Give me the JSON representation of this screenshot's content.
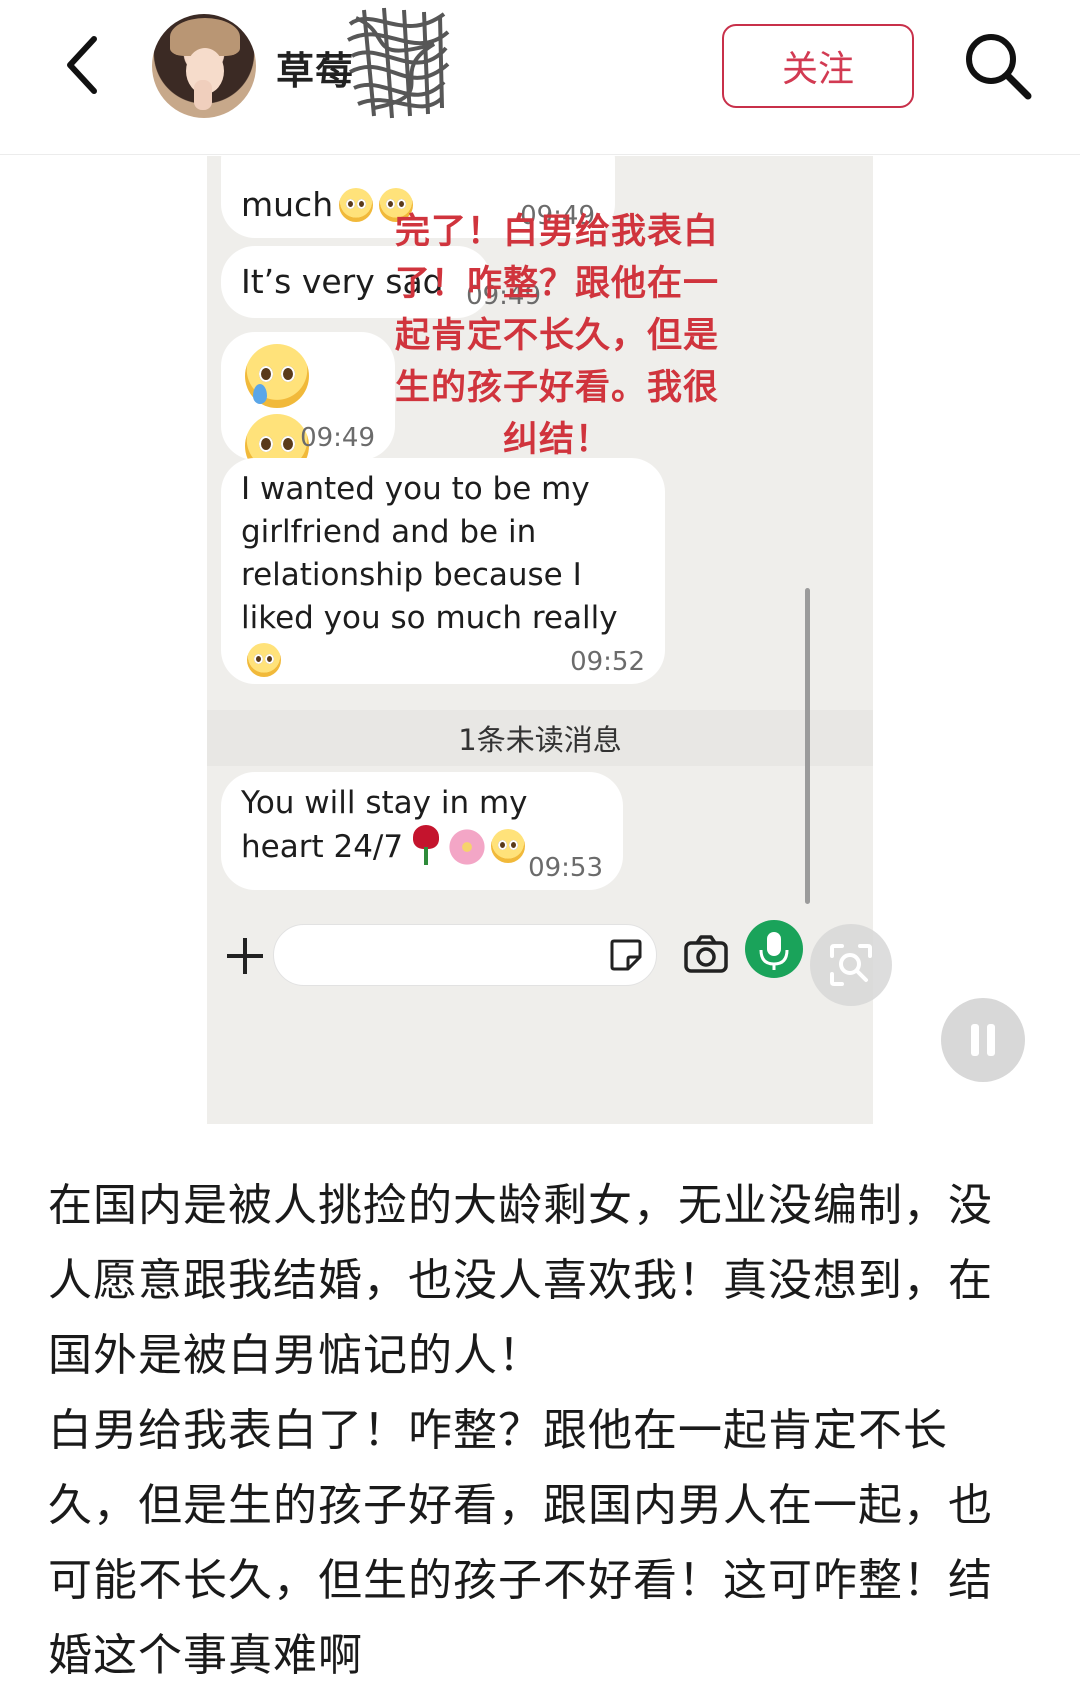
{
  "header": {
    "username": "草莓",
    "follow_label": "关注"
  },
  "chat": {
    "messages": [
      {
        "text": "much",
        "time": "09:49"
      },
      {
        "text": "It’s very sad",
        "time": "09:49"
      },
      {
        "text": "",
        "time": "09:49"
      },
      {
        "text": "I wanted you to be my girlfriend and be in relationship because I liked you so much really",
        "time": "09:52"
      },
      {
        "text": "You will stay in my heart 24/7",
        "time": "09:53"
      }
    ],
    "overlay_caption": "完了！白男给我表白了！咋整？跟他在一起肯定不长久，但是生的孩子好看。我很纠结！",
    "unread_divider": "1条未读消息"
  },
  "post": {
    "paragraph1": "在国内是被人挑捡的大龄剩女，无业没编制，没人愿意跟我结婚，也没人喜欢我！真没想到，在国外是被白男惦记的人！",
    "paragraph2": "白男给我表白了！咋整？跟他在一起肯定不长久，但是生的孩子好看，跟国内男人在一起，也可能不长久，但生的孩子不好看！这可咋整！结婚这个事真难啊"
  },
  "colors": {
    "follow_accent": "#d23a52",
    "overlay_text": "#d0343d",
    "mic_button": "#1aa35a"
  },
  "icons": [
    "back-icon",
    "search-icon",
    "plus-icon",
    "sticker-icon",
    "camera-icon",
    "mic-icon",
    "lens-icon",
    "pause-icon"
  ]
}
